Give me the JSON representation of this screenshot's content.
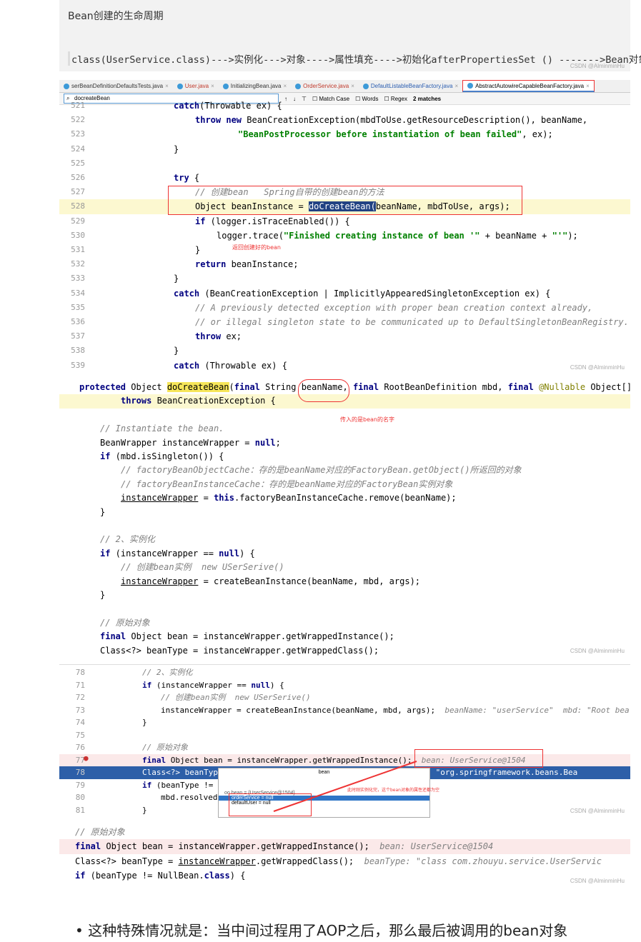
{
  "lifecycle": {
    "title": "Bean创建的生命周期",
    "flow": "class(UserService.class)--->实例化--->对象---->属性填充---->初始化afterPropertiesSet () ------->Bean对象",
    "watermark": "CSDN @AlminminHu"
  },
  "ide": {
    "tabs": [
      {
        "label": "serBeanDefinitionDefaultsTests.java",
        "color": "#333"
      },
      {
        "label": "User.java",
        "color": "#c0392b"
      },
      {
        "label": "InitializingBean.java",
        "color": "#333"
      },
      {
        "label": "OrderService.java",
        "color": "#c0392b"
      },
      {
        "label": "DefaultListableBeanFactory.java",
        "color": "#2a5db0"
      },
      {
        "label": "AbstractAutowireCapableBeanFactory.java",
        "color": "#000",
        "active": true
      }
    ],
    "search": {
      "value": "docreateBean",
      "match_case": "Match Case",
      "words": "Words",
      "regex": "Regex",
      "matches": "2 matches"
    },
    "lines": [
      {
        "n": "521",
        "i": 2,
        "t": [
          [
            "kw",
            "catch"
          ],
          [
            "",
            "(Throwable ex) {"
          ]
        ]
      },
      {
        "n": "522",
        "i": 3,
        "t": [
          [
            "kw",
            "throw new "
          ],
          [
            "",
            "BeanCreationException(mbdToUse.getResourceDescription(), beanName,"
          ]
        ]
      },
      {
        "n": "523",
        "i": 5,
        "t": [
          [
            "str",
            "\"BeanPostProcessor before instantiation of bean failed\""
          ],
          [
            "",
            ", ex);"
          ]
        ]
      },
      {
        "n": "524",
        "i": 2,
        "t": [
          [
            "",
            "}"
          ]
        ]
      },
      {
        "n": "525",
        "i": 0,
        "t": []
      },
      {
        "n": "526",
        "i": 2,
        "t": [
          [
            "kw",
            "try"
          ],
          [
            "",
            " {"
          ]
        ]
      },
      {
        "n": "527",
        "i": 3,
        "t": [
          [
            "cm",
            "// 创建bean   Spring自带的创建bean的方法"
          ]
        ]
      },
      {
        "n": "528",
        "i": 3,
        "hl": "hl",
        "t": [
          [
            "",
            "Object beanInstance = "
          ],
          [
            "sel",
            "doCreateBean("
          ],
          [
            "",
            "beanName, mbdToUse, args);"
          ]
        ]
      },
      {
        "n": "529",
        "i": 3,
        "t": [
          [
            "kw",
            "if"
          ],
          [
            "",
            " (logger.isTraceEnabled()) {"
          ]
        ]
      },
      {
        "n": "530",
        "i": 4,
        "t": [
          [
            "",
            "logger.trace("
          ],
          [
            "str",
            "\"Finished creating instance of bean '\""
          ],
          [
            "",
            " + beanName + "
          ],
          [
            "str",
            "\"'\""
          ],
          [
            "",
            ");"
          ]
        ]
      },
      {
        "n": "531",
        "i": 3,
        "t": [
          [
            "",
            "}"
          ]
        ]
      },
      {
        "n": "532",
        "i": 3,
        "t": [
          [
            "kw",
            "return"
          ],
          [
            "",
            " beanInstance;"
          ]
        ]
      },
      {
        "n": "533",
        "i": 2,
        "t": [
          [
            "",
            "}"
          ]
        ]
      },
      {
        "n": "534",
        "i": 2,
        "t": [
          [
            "kw",
            "catch"
          ],
          [
            "",
            " (BeanCreationException | ImplicitlyAppearedSingletonException ex) {"
          ]
        ]
      },
      {
        "n": "535",
        "i": 3,
        "t": [
          [
            "cm",
            "// A previously detected exception with proper bean creation context already,"
          ]
        ]
      },
      {
        "n": "536",
        "i": 3,
        "t": [
          [
            "cm",
            "// or illegal singleton state to be communicated up to DefaultSingletonBeanRegistry."
          ]
        ]
      },
      {
        "n": "537",
        "i": 3,
        "t": [
          [
            "kw",
            "throw"
          ],
          [
            "",
            " ex;"
          ]
        ]
      },
      {
        "n": "538",
        "i": 2,
        "t": [
          [
            "",
            "}"
          ]
        ]
      },
      {
        "n": "539",
        "i": 2,
        "t": [
          [
            "kw",
            "catch"
          ],
          [
            "",
            " (Throwable ex) {"
          ]
        ]
      }
    ],
    "note": "返回创建好的bean"
  },
  "method": {
    "lines": [
      {
        "i": 0,
        "t": [
          [
            "kw",
            "protected "
          ],
          [
            "",
            "Object "
          ],
          [
            "yel",
            "doCreateBean"
          ],
          [
            "",
            "("
          ],
          [
            "kw",
            "final "
          ],
          [
            "",
            "String beanName, "
          ],
          [
            "kw",
            "final "
          ],
          [
            "",
            "RootBeanDefinition mbd, "
          ],
          [
            "kw",
            "final "
          ],
          [
            "an",
            "@Nullable "
          ],
          [
            "",
            "Object[]"
          ]
        ]
      },
      {
        "i": 2,
        "hl": "hl",
        "t": [
          [
            "kw",
            "throws "
          ],
          [
            "",
            "BeanCreationException {"
          ]
        ]
      },
      {
        "i": 0,
        "t": []
      },
      {
        "i": 1,
        "t": [
          [
            "cm",
            "// Instantiate the bean."
          ]
        ]
      },
      {
        "i": 1,
        "t": [
          [
            "",
            "BeanWrapper instanceWrapper = "
          ],
          [
            "kw",
            "null"
          ],
          [
            "",
            ";"
          ]
        ]
      },
      {
        "i": 1,
        "t": [
          [
            "kw",
            "if"
          ],
          [
            "",
            " (mbd.isSingleton()) {"
          ]
        ]
      },
      {
        "i": 2,
        "t": [
          [
            "cm",
            "// factoryBeanObjectCache：存的是beanName对应的FactoryBean.getObject()所返回的对象"
          ]
        ]
      },
      {
        "i": 2,
        "t": [
          [
            "cm",
            "// factoryBeanInstanceCache：存的是beanName对应的FactoryBean实例对象"
          ]
        ]
      },
      {
        "i": 2,
        "t": [
          [
            "ul",
            "instanceWrapper"
          ],
          [
            "",
            " = "
          ],
          [
            "kw",
            "this"
          ],
          [
            "",
            ".factoryBeanInstanceCache.remove(beanName);"
          ]
        ]
      },
      {
        "i": 1,
        "t": [
          [
            "",
            "}"
          ]
        ]
      },
      {
        "i": 0,
        "t": []
      },
      {
        "i": 1,
        "t": [
          [
            "cm",
            "// 2、实例化"
          ]
        ]
      },
      {
        "i": 1,
        "t": [
          [
            "kw",
            "if"
          ],
          [
            "",
            " (instanceWrapper == "
          ],
          [
            "kw",
            "null"
          ],
          [
            "",
            ") {"
          ]
        ]
      },
      {
        "i": 2,
        "t": [
          [
            "cm",
            "// 创建bean实例  new USerSerive()"
          ]
        ]
      },
      {
        "i": 2,
        "t": [
          [
            "ul",
            "instanceWrapper"
          ],
          [
            "",
            " = createBeanInstance(beanName, mbd, args);"
          ]
        ]
      },
      {
        "i": 1,
        "t": [
          [
            "",
            "}"
          ]
        ]
      },
      {
        "i": 0,
        "t": []
      },
      {
        "i": 1,
        "t": [
          [
            "cm",
            "// 原始对象"
          ]
        ]
      },
      {
        "i": 1,
        "t": [
          [
            "kw",
            "final "
          ],
          [
            "",
            "Object bean = instanceWrapper.getWrappedInstance();"
          ]
        ]
      },
      {
        "i": 1,
        "t": [
          [
            "",
            "Class<?> beanType = instanceWrapper.getWrappedClass();"
          ]
        ]
      }
    ],
    "note": "传入的是bean的名字"
  },
  "debug": {
    "lines": [
      {
        "n": "78",
        "i": 1,
        "t": [
          [
            "cm",
            "// 2、实例化"
          ]
        ]
      },
      {
        "n": "71",
        "i": 1,
        "t": [
          [
            "kw",
            "if"
          ],
          [
            "",
            " (instanceWrapper == "
          ],
          [
            "kw",
            "null"
          ],
          [
            "",
            ") {"
          ]
        ]
      },
      {
        "n": "72",
        "i": 2,
        "t": [
          [
            "cm",
            "// 创建bean实例  new USerSerive()"
          ]
        ]
      },
      {
        "n": "73",
        "i": 2,
        "t": [
          [
            "",
            "instanceWrapper = createBeanInstance(beanName, mbd, args);  "
          ],
          [
            "cm",
            "beanName: \"userService\"  mbd: \"Root bea"
          ]
        ]
      },
      {
        "n": "74",
        "i": 1,
        "t": [
          [
            "",
            "}"
          ]
        ]
      },
      {
        "n": "75",
        "i": 0,
        "t": []
      },
      {
        "n": "76",
        "i": 1,
        "t": [
          [
            "cm",
            "// 原始对象"
          ]
        ]
      },
      {
        "n": "77",
        "i": 1,
        "hl": "hlr",
        "t": [
          [
            "kw",
            "final "
          ],
          [
            "",
            "Object bean = instanceWrapper.getWrappedInstance();  "
          ],
          [
            "cm",
            "bean: UserService@1504"
          ]
        ]
      },
      {
        "n": "78",
        "i": 1,
        "hl": "hlb",
        "t": [
          [
            "",
            "Class<?> beanTyp                                  nceWrapper: \"org.springframework.beans.Bea"
          ]
        ]
      },
      {
        "n": "79",
        "i": 1,
        "t": [
          [
            "kw",
            "if"
          ],
          [
            "",
            " (beanType != "
          ]
        ]
      },
      {
        "n": "80",
        "i": 2,
        "t": [
          [
            "",
            "mbd.resolved"
          ]
        ]
      },
      {
        "n": "81",
        "i": 1,
        "t": [
          [
            "",
            "}"
          ]
        ]
      }
    ],
    "popup": {
      "title": "bean",
      "root": "oo bean = {UserService@1504}",
      "items": [
        "orderService = null",
        "defaultUser = null"
      ]
    },
    "note": "此时刚实例化完，这个bean对象的属性还都为空"
  },
  "final": {
    "lines": [
      {
        "i": 0,
        "t": [
          [
            "cm",
            "// 原始对象"
          ]
        ]
      },
      {
        "i": 0,
        "hl": "hlr",
        "t": [
          [
            "kw",
            "final "
          ],
          [
            "",
            "Object bean = instanceWrapper.getWrappedInstance();  "
          ],
          [
            "cm",
            "bean: UserService@1504"
          ]
        ]
      },
      {
        "i": 0,
        "t": [
          [
            "",
            "Class<?> beanType = "
          ],
          [
            "ul",
            "instanceWrapper"
          ],
          [
            "",
            ".getWrappedClass();  "
          ],
          [
            "cm",
            "beanType: \"class com.zhouyu.service.UserServic"
          ]
        ]
      },
      {
        "i": 0,
        "t": [
          [
            "kw",
            "if"
          ],
          [
            "",
            " (beanType != NullBean."
          ],
          [
            "kw",
            "class"
          ],
          [
            "",
            ") {"
          ]
        ]
      }
    ]
  },
  "bullet": "这种特殊情况就是：当中间过程用了AOP之后，那么最后被调用的bean对象"
}
